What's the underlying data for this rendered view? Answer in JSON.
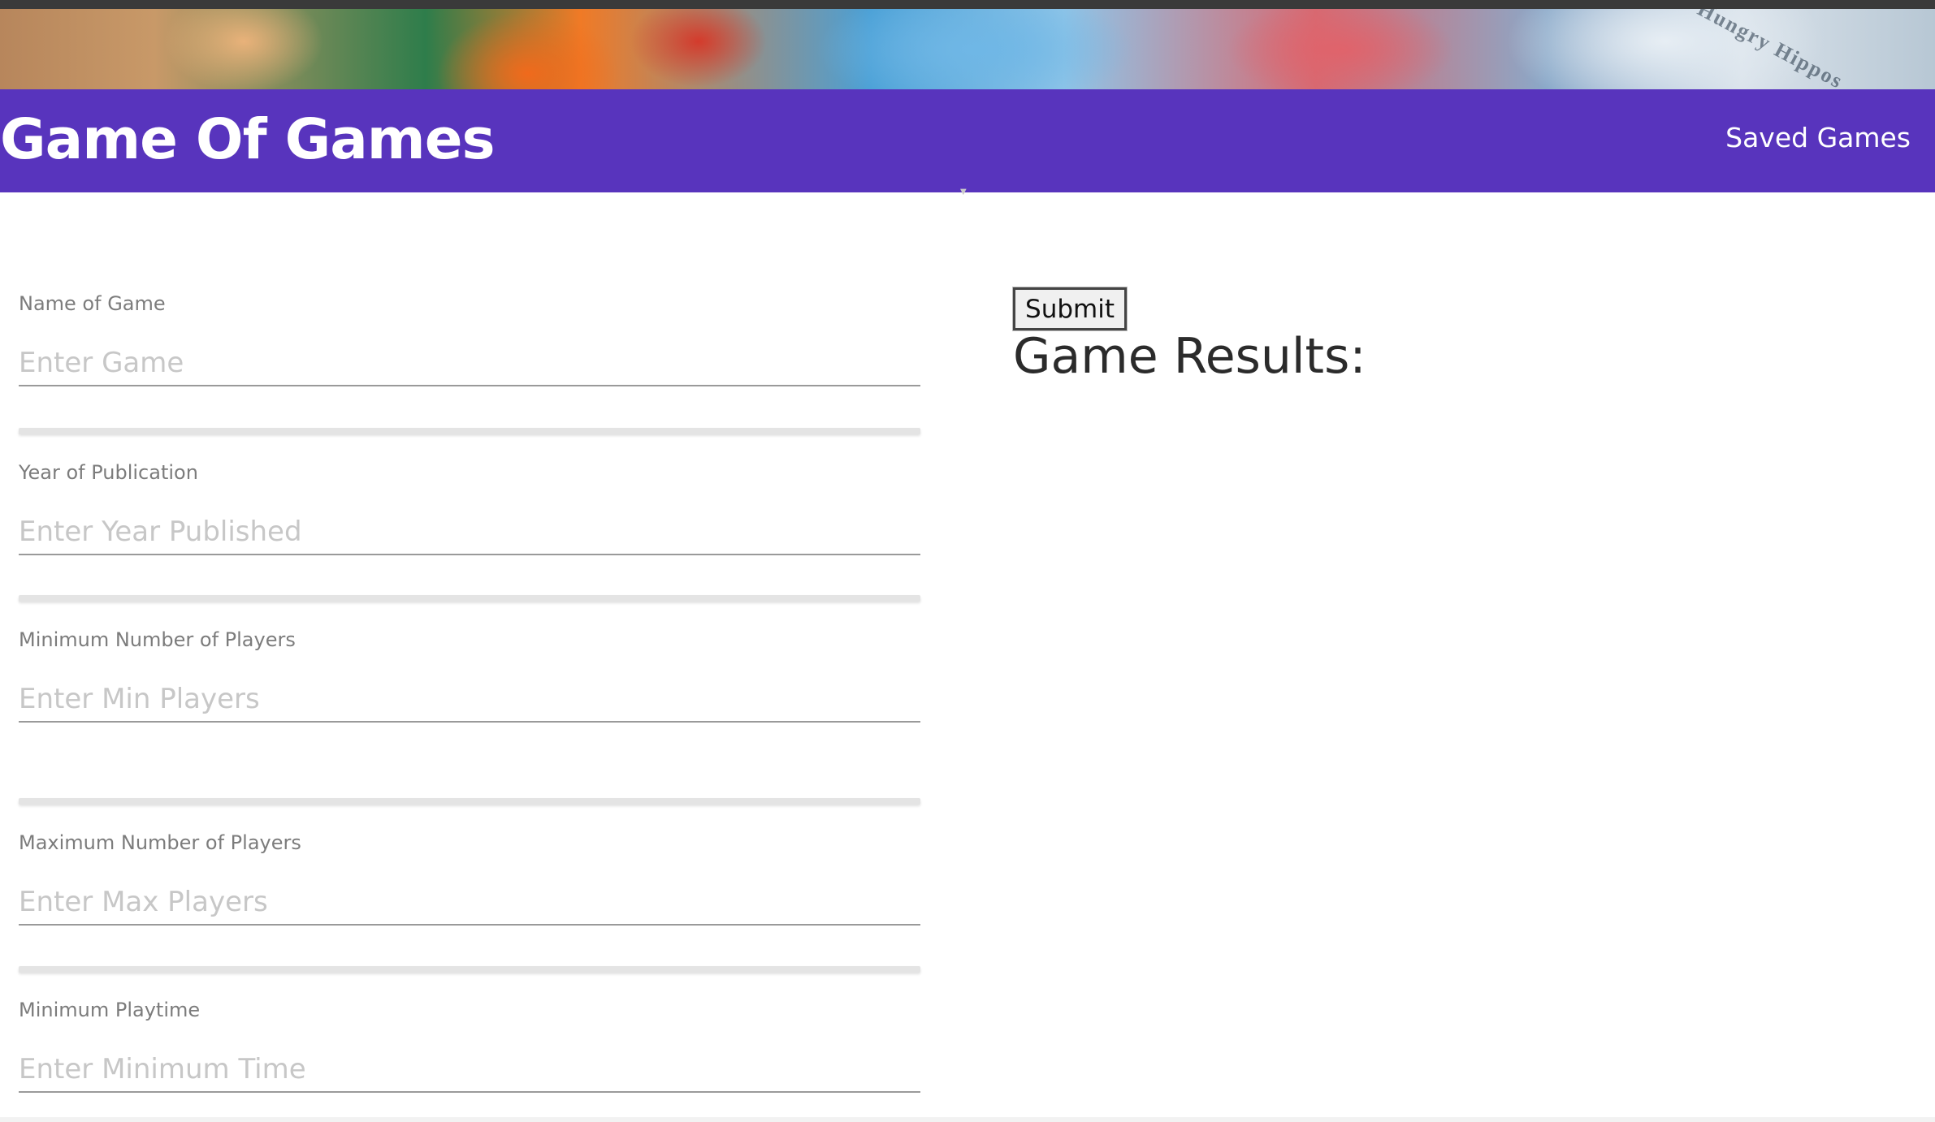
{
  "header": {
    "title": "Game Of Games",
    "nav_link": "Saved Games",
    "colors": {
      "navbar": "#5834bd",
      "text": "#ffffff"
    }
  },
  "form": {
    "fields": [
      {
        "label": "Name of Game",
        "placeholder": "Enter Game",
        "value": ""
      },
      {
        "label": "Year of Publication",
        "placeholder": "Enter Year Published",
        "value": ""
      },
      {
        "label": "Minimum Number of Players",
        "placeholder": "Enter Min Players",
        "value": ""
      },
      {
        "label": "Maximum Number of Players",
        "placeholder": "Enter Max Players",
        "value": ""
      },
      {
        "label": "Minimum Playtime",
        "placeholder": "Enter Minimum Time",
        "value": ""
      }
    ]
  },
  "actions": {
    "submit_label": "Submit"
  },
  "results": {
    "title": "Game Results:"
  }
}
